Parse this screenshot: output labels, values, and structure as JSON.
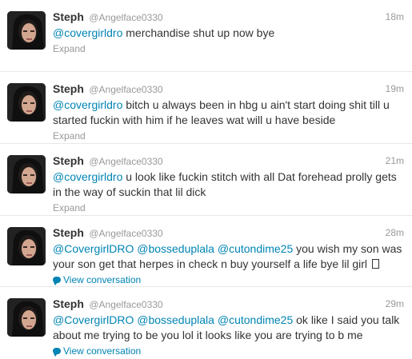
{
  "tweets": [
    {
      "fullname": "Steph",
      "username": "@Angelface0330",
      "time": "18m",
      "mentions": [
        "@covergirldro"
      ],
      "body": " merchandise shut up now bye",
      "footer": "Expand"
    },
    {
      "fullname": "Steph",
      "username": "@Angelface0330",
      "time": "19m",
      "mentions": [
        "@covergirldro"
      ],
      "body": " bitch u always been in hbg u ain't start doing shit till u started fuckin with him if he leaves wat will u have beside",
      "footer": "Expand"
    },
    {
      "fullname": "Steph",
      "username": "@Angelface0330",
      "time": "21m",
      "mentions": [
        "@covergirldro"
      ],
      "body": " u look like fuckin stitch with all Dat forehead prolly gets in the way of suckin that lil dick",
      "footer": "Expand"
    },
    {
      "fullname": "Steph",
      "username": "@Angelface0330",
      "time": "28m",
      "mentions": [
        "@CovergirlDRO",
        "@bosseduplala",
        "@cutondime25"
      ],
      "body": " you wish my son was your son get that herpes in check n buy yourself a life bye lil girl",
      "footer": "View conversation"
    },
    {
      "fullname": "Steph",
      "username": "@Angelface0330",
      "time": "29m",
      "mentions": [
        "@CovergirlDRO",
        "@bosseduplala",
        "@cutondime25"
      ],
      "body": " ok like I said you talk about me trying to be you lol it looks like you are trying to b me",
      "footer": "View conversation"
    }
  ],
  "icons": {
    "conversation": "speech-bubble-icon",
    "missing_glyph": "unknown-glyph-box"
  },
  "colors": {
    "link": "#0084b4",
    "muted": "#999999",
    "text": "#333333",
    "divider": "#e8e8e8"
  }
}
